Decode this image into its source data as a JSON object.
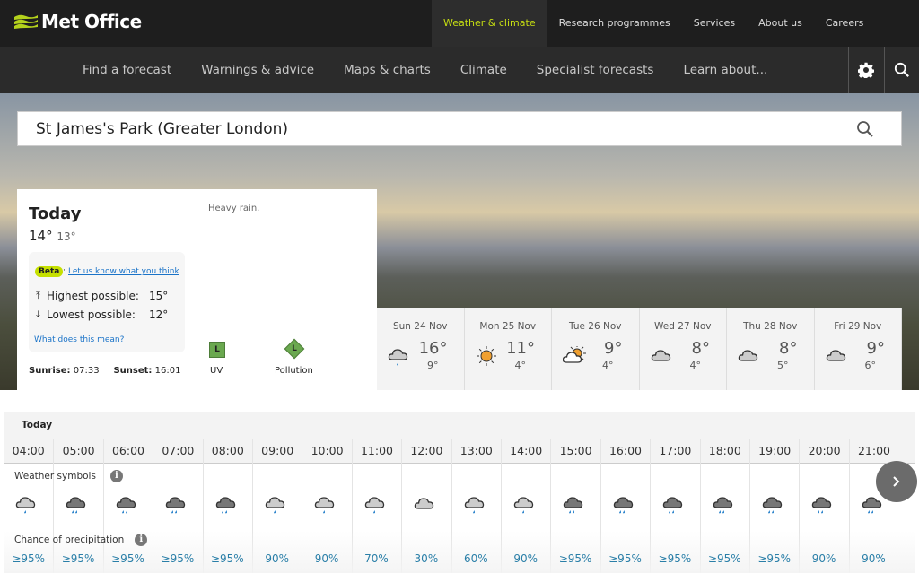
{
  "header": {
    "logo": "Met Office",
    "top_links": [
      {
        "label": "Weather & climate",
        "active": true
      },
      {
        "label": "Research programmes"
      },
      {
        "label": "Services"
      },
      {
        "label": "About us"
      },
      {
        "label": "Careers"
      }
    ],
    "main_nav": [
      "Find a forecast",
      "Warnings & advice",
      "Maps & charts",
      "Climate",
      "Specialist forecasts",
      "Learn about..."
    ],
    "icons": [
      "gear-icon",
      "search-icon"
    ],
    "accent": "#c5e000"
  },
  "search": {
    "value": "St James's Park (Greater London)"
  },
  "today": {
    "title": "Today",
    "high": "14°",
    "low": "13°",
    "beta": "Beta",
    "feedback_link": "Let us know what you think",
    "highest_label": "Highest possible:",
    "highest": "15°",
    "lowest_label": "Lowest possible:",
    "lowest": "12°",
    "what_link": "What does this mean?",
    "sunrise_label": "Sunrise:",
    "sunrise": "07:33",
    "sunset_label": "Sunset:",
    "sunset": "16:01",
    "description": "Heavy rain.",
    "uv_label": "UV",
    "uv_level": "L",
    "pollution_label": "Pollution",
    "pollution_level": "L"
  },
  "days": [
    {
      "name": "Sun 24 Nov",
      "high": "16°",
      "low": "9°",
      "icon": "light-rain"
    },
    {
      "name": "Mon 25 Nov",
      "high": "11°",
      "low": "4°",
      "icon": "sunny"
    },
    {
      "name": "Tue 26 Nov",
      "high": "9°",
      "low": "4°",
      "icon": "sunny-intervals"
    },
    {
      "name": "Wed 27 Nov",
      "high": "8°",
      "low": "4°",
      "icon": "cloudy"
    },
    {
      "name": "Thu 28 Nov",
      "high": "8°",
      "low": "5°",
      "icon": "cloudy"
    },
    {
      "name": "Fri 29 Nov",
      "high": "9°",
      "low": "6°",
      "icon": "cloudy"
    }
  ],
  "hourly": {
    "day_label": "Today",
    "symbols_label": "Weather symbols",
    "precip_label": "Chance of precipitation",
    "hours": [
      {
        "time": "04:00",
        "icon": "light-rain",
        "precip": "≥95%"
      },
      {
        "time": "05:00",
        "icon": "heavy-rain",
        "precip": "≥95%"
      },
      {
        "time": "06:00",
        "icon": "heavy-rain",
        "precip": "≥95%"
      },
      {
        "time": "07:00",
        "icon": "heavy-rain",
        "precip": "≥95%"
      },
      {
        "time": "08:00",
        "icon": "heavy-rain",
        "precip": "≥95%"
      },
      {
        "time": "09:00",
        "icon": "light-rain",
        "precip": "90%"
      },
      {
        "time": "10:00",
        "icon": "light-rain",
        "precip": "90%"
      },
      {
        "time": "11:00",
        "icon": "light-rain",
        "precip": "70%"
      },
      {
        "time": "12:00",
        "icon": "cloudy",
        "precip": "30%"
      },
      {
        "time": "13:00",
        "icon": "light-rain",
        "precip": "60%"
      },
      {
        "time": "14:00",
        "icon": "light-rain",
        "precip": "90%"
      },
      {
        "time": "15:00",
        "icon": "heavy-rain",
        "precip": "≥95%"
      },
      {
        "time": "16:00",
        "icon": "heavy-rain",
        "precip": "≥95%"
      },
      {
        "time": "17:00",
        "icon": "heavy-rain",
        "precip": "≥95%"
      },
      {
        "time": "18:00",
        "icon": "heavy-rain",
        "precip": "≥95%"
      },
      {
        "time": "19:00",
        "icon": "heavy-rain",
        "precip": "≥95%"
      },
      {
        "time": "20:00",
        "icon": "heavy-rain",
        "precip": "90%"
      },
      {
        "time": "21:00",
        "icon": "heavy-rain",
        "precip": "90%"
      }
    ]
  }
}
